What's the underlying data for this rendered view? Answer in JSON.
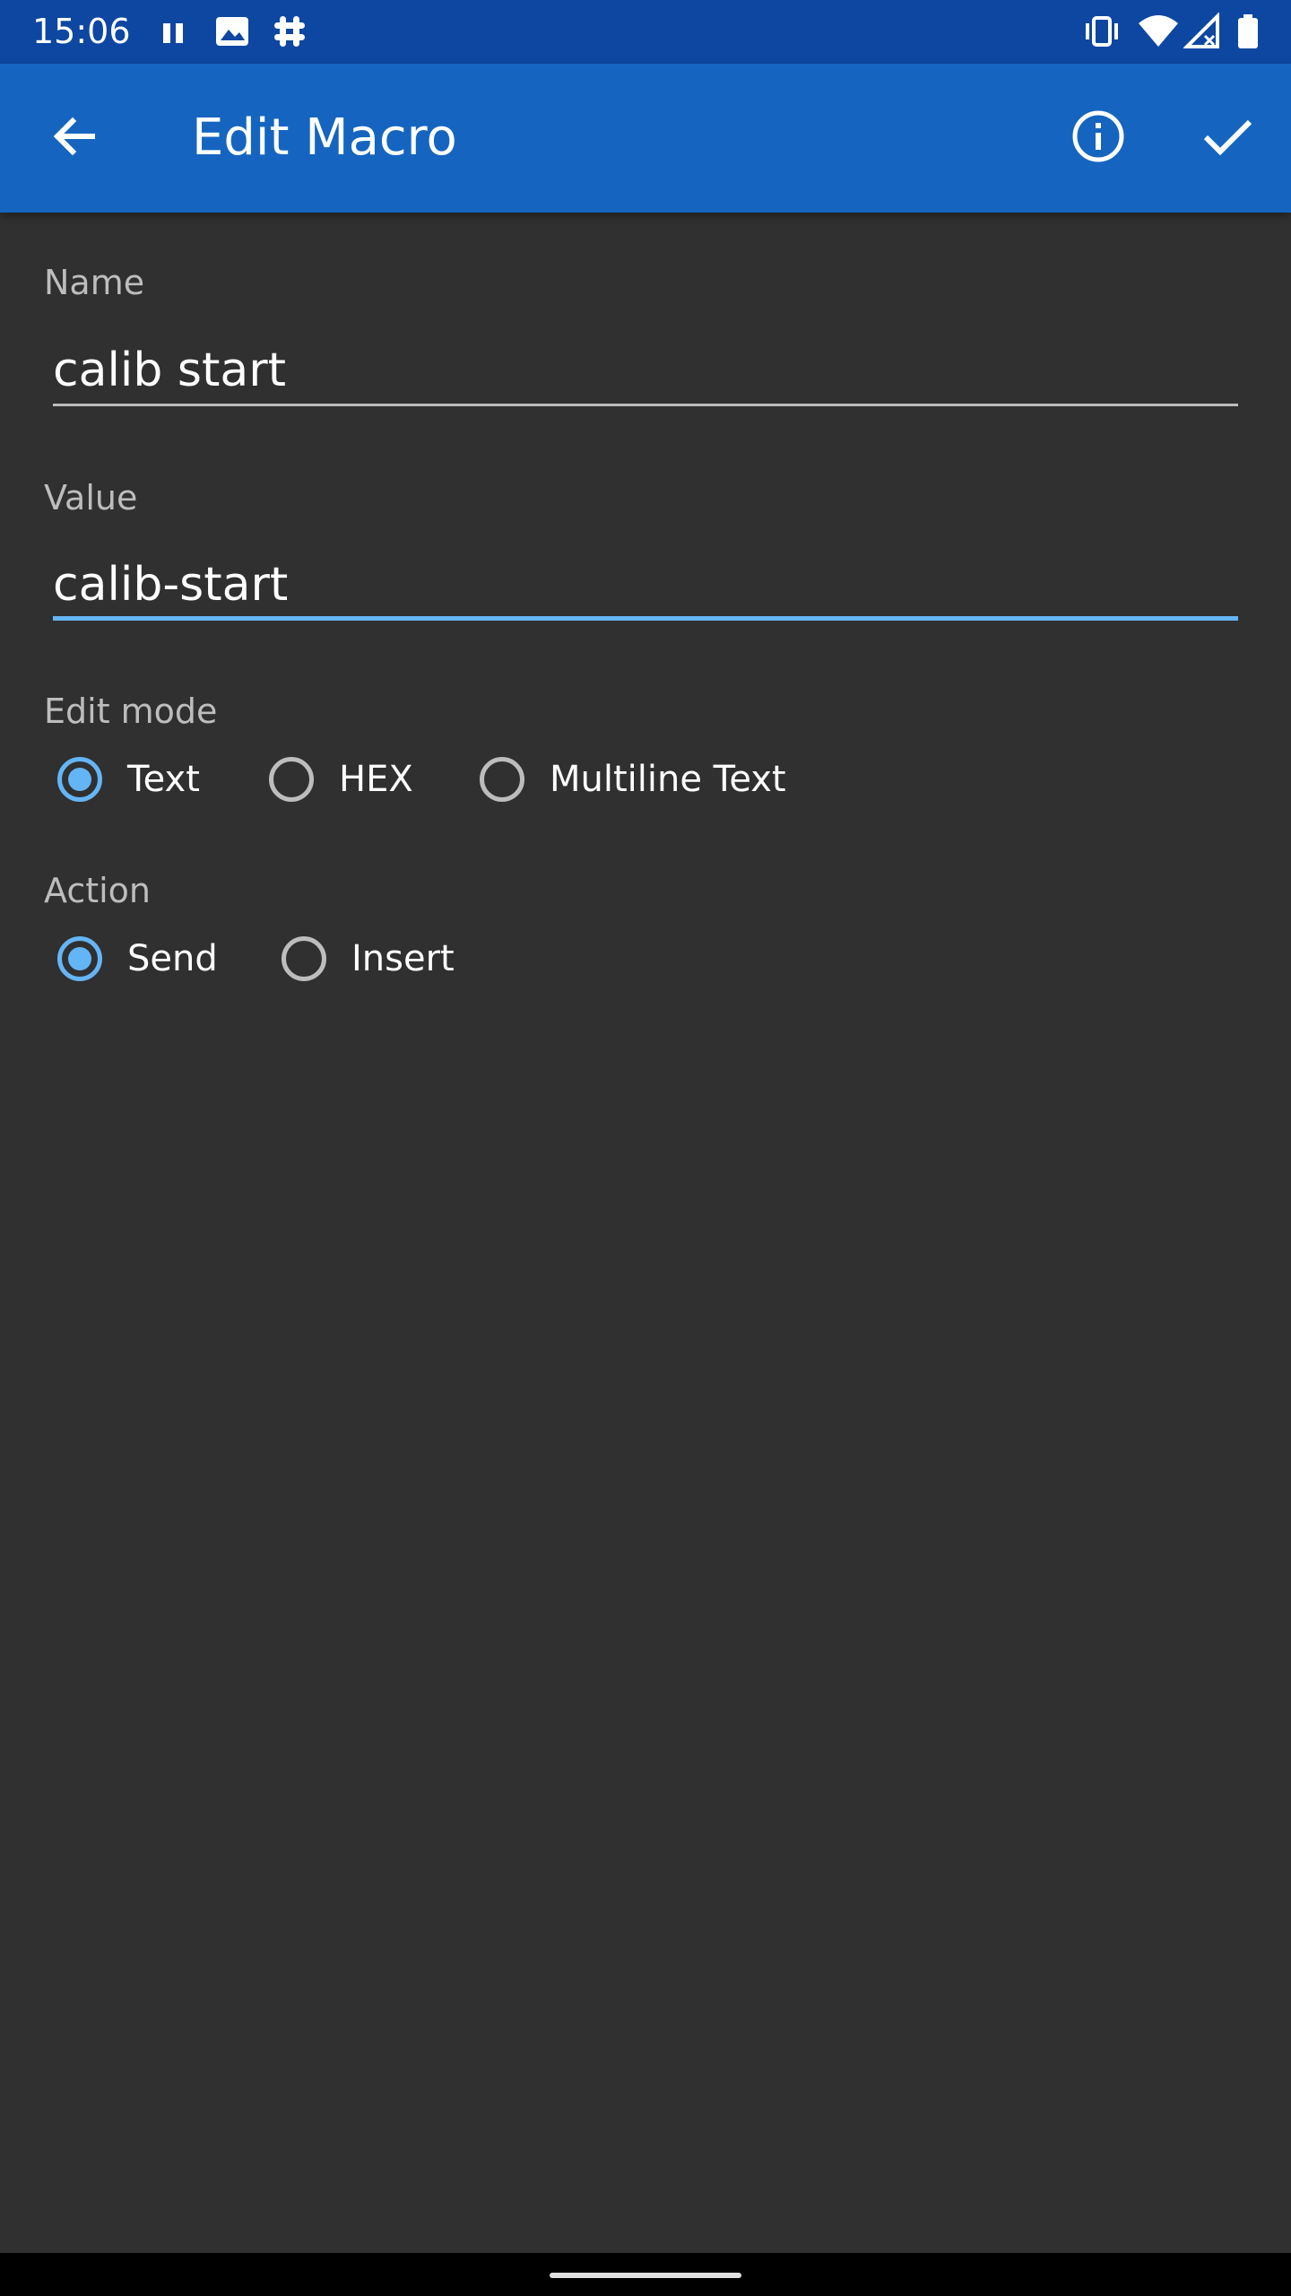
{
  "status_bar": {
    "time": "15:06",
    "left_icons": [
      "pause-icon",
      "image-icon",
      "slack-icon"
    ],
    "right_icons": [
      "vibrate-icon",
      "wifi-icon",
      "signal-icon",
      "battery-icon"
    ]
  },
  "app_bar": {
    "title": "Edit Macro",
    "back_icon": "arrow-left-icon",
    "info_icon": "info-icon",
    "confirm_icon": "check-icon"
  },
  "form": {
    "name": {
      "label": "Name",
      "value": "calib start"
    },
    "value": {
      "label": "Value",
      "value": "calib-start"
    },
    "edit_mode": {
      "label": "Edit mode",
      "options": [
        "Text",
        "HEX",
        "Multiline Text"
      ],
      "selected": "Text"
    },
    "action": {
      "label": "Action",
      "options": [
        "Send",
        "Insert"
      ],
      "selected": "Send"
    }
  },
  "colors": {
    "status_bar": "#0d47a1",
    "app_bar": "#1565c0",
    "background": "#303030",
    "accent": "#64b5f6"
  }
}
